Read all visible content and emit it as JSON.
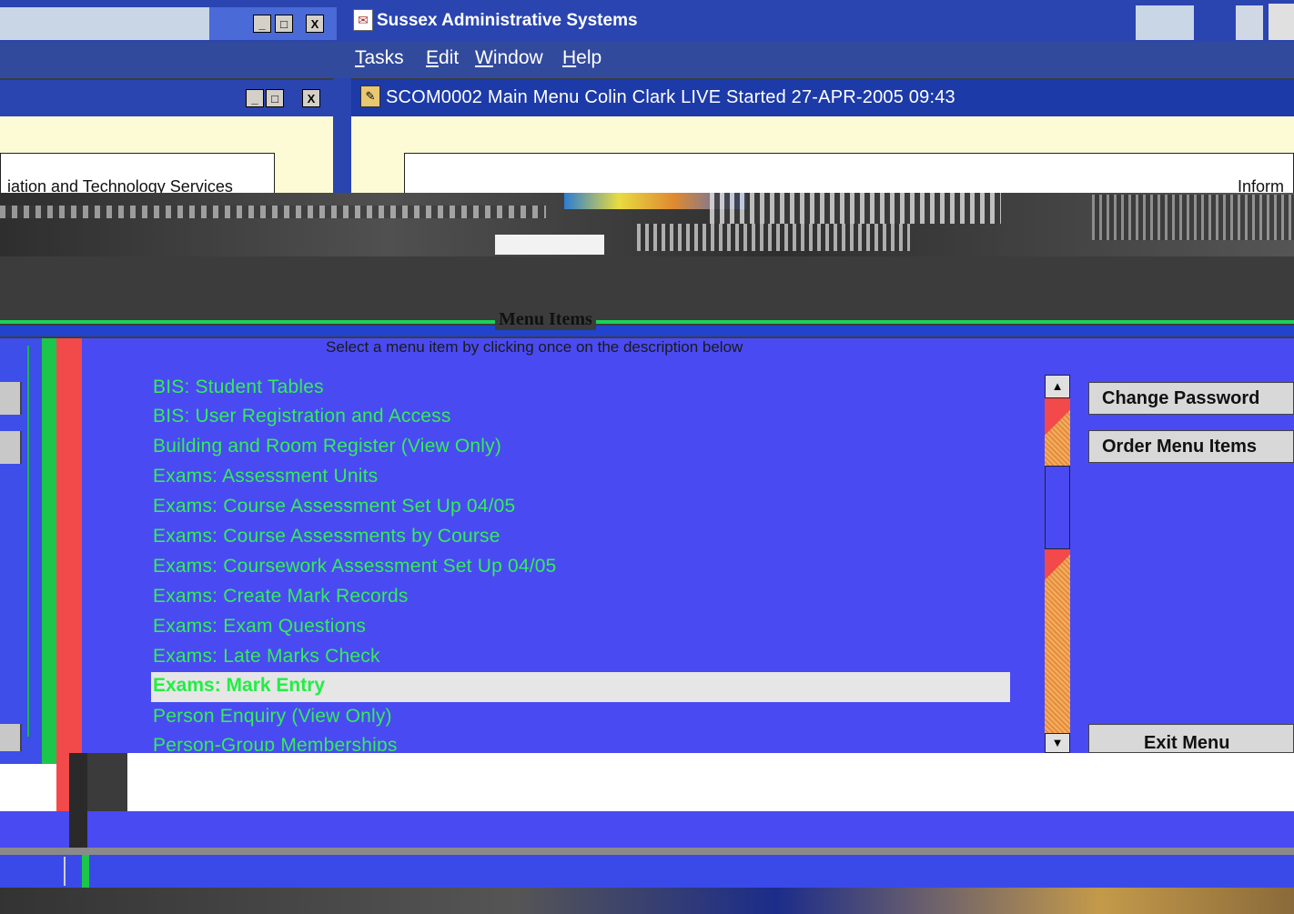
{
  "app": {
    "title": "Sussex Administrative Systems",
    "icon": "app-logo-icon",
    "window_buttons": [
      "_",
      "□",
      "X"
    ]
  },
  "menubar": {
    "items": [
      "Tasks",
      "Edit",
      "Window",
      "Help"
    ]
  },
  "left_window": {
    "partial_text": "iation and Technology Services",
    "window_buttons": [
      "_",
      "□",
      "X"
    ]
  },
  "main_window": {
    "title": "SCOM0002  Main Menu  Colin Clark LIVE  Started 27-APR-2005 09:43",
    "partial_text": "Inform"
  },
  "menu_panel": {
    "frame_title": "Menu Items",
    "instruction": "Select a menu item by clicking once on the description below",
    "items": [
      "BIS: Student Tables",
      "BIS: User Registration and Access",
      "Building and Room Register (View Only)",
      "Exams: Assessment Units",
      "Exams: Course Assessment Set Up 04/05",
      "Exams: Course Assessments by Course",
      "Exams: Coursework Assessment Set Up 04/05",
      "Exams: Create Mark Records",
      "Exams: Exam Questions",
      "Exams: Late Marks Check",
      "Exams: Mark Entry",
      "Person Enquiry (View Only)",
      "Person-Group Memberships"
    ],
    "selected_index": 10,
    "selected_item": "Exams: Mark Entry"
  },
  "buttons": {
    "change_password": "Change Password",
    "order_menu_items": "Order Menu Items",
    "exit_menu": "Exit Menu"
  },
  "scrollbar": {
    "up_arrow": "▲",
    "down_arrow": "▼"
  },
  "colors": {
    "panel": "#4a4af2",
    "item_text": "#33ee55",
    "selected_bg": "#e6e6e6",
    "title_bar": "#2a44b0",
    "yellow_body": "#fdfbd6"
  }
}
